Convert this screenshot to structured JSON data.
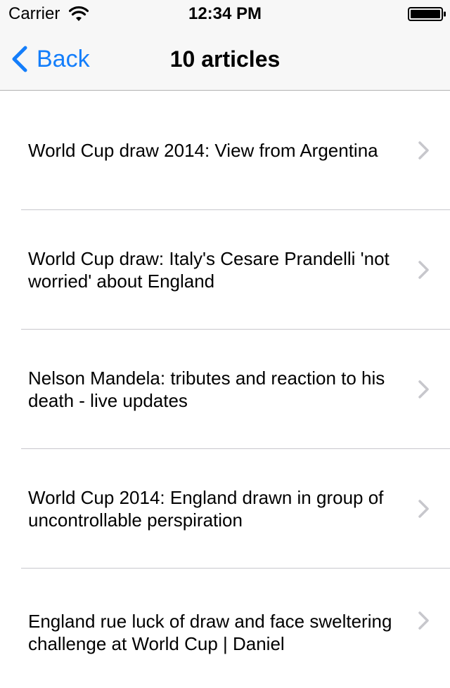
{
  "status_bar": {
    "carrier": "Carrier",
    "time": "12:34 PM",
    "wifi_icon": "wifi-icon",
    "battery_icon": "battery-icon"
  },
  "nav": {
    "back_label": "Back",
    "back_icon": "chevron-left-icon",
    "title": "10 articles",
    "accent_color": "#147efb"
  },
  "articles": [
    {
      "title": "World Cup draw 2014: View from Argentina"
    },
    {
      "title": "World Cup draw: Italy's Cesare Prandelli 'not worried' about England"
    },
    {
      "title": "Nelson Mandela: tributes and reaction to his death - live updates"
    },
    {
      "title": "World Cup 2014: England drawn in group of uncontrollable perspiration"
    },
    {
      "title": "England rue luck of draw and face sweltering challenge at World Cup | Daniel"
    }
  ]
}
